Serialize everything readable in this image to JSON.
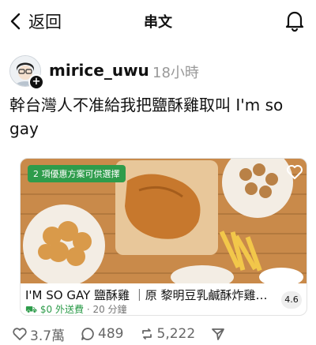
{
  "header": {
    "back_label": "返回",
    "title": "串文"
  },
  "post": {
    "username": "mirice_uwu",
    "timestamp": "18小時",
    "text": "幹台灣人不准給我把鹽酥雞取叫 I'm so gay"
  },
  "card": {
    "promo": "2 項優惠方案可供選擇",
    "title": "I'M SO GAY 鹽酥雞 ｜原 黎明豆乳鹹酥炸雞專...",
    "fee": "$0 外送費",
    "eta": "20 分鐘",
    "rating": "4.6"
  },
  "actions": {
    "likes": "3.7萬",
    "comments": "489",
    "reposts": "5,222"
  },
  "colors": {
    "promo_green": "#2e9c4b",
    "text_primary": "#111111",
    "text_muted": "#999999"
  },
  "icons": [
    "chevron-left-icon",
    "bell-icon",
    "heart-icon",
    "comment-icon",
    "repost-icon",
    "send-icon"
  ]
}
